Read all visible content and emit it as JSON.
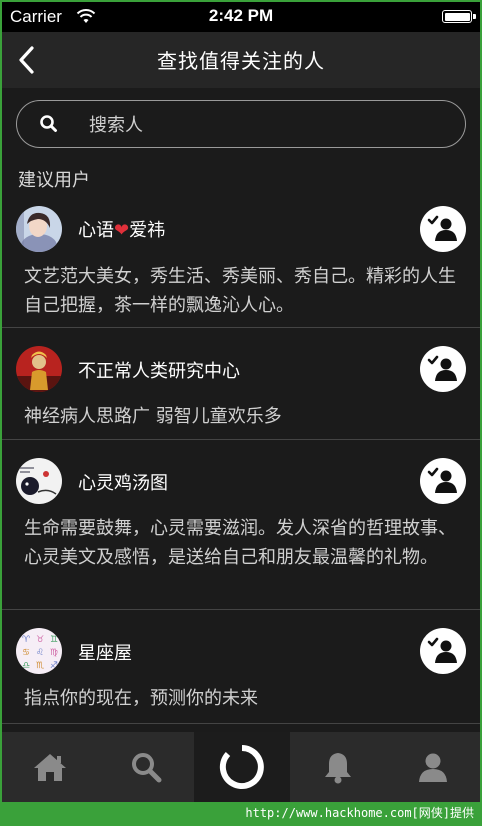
{
  "status_bar": {
    "carrier": "Carrier",
    "time": "2:42 PM",
    "battery_level": 1.0
  },
  "nav": {
    "title": "查找值得关注的人"
  },
  "search": {
    "placeholder": "搜索人"
  },
  "section": {
    "title": "建议用户"
  },
  "users": [
    {
      "name_before": "心语",
      "name_emoji": "❤",
      "name_after": "爱祎",
      "description": "文艺范大美女，秀生活、秀美丽、秀自己。精彩的人生自己把握，茶一样的飘逸沁人心。"
    },
    {
      "name": "不正常人类研究中心",
      "description": "神经病人思路广 弱智儿童欢乐多"
    },
    {
      "name": "心灵鸡汤图",
      "description": "生命需要鼓舞，心灵需要滋润。发人深省的哲理故事、心灵美文及感悟，是送给自己和朋友最温馨的礼物。"
    },
    {
      "name": "星座屋",
      "description": "指点你的现在，预测你的未来"
    }
  ],
  "tabbar": {
    "items": [
      "home-icon",
      "search-icon",
      "refresh-icon",
      "bell-icon",
      "profile-icon"
    ],
    "active_index": 2
  },
  "footer": {
    "text": "http://www.hackhome.com[网侠]提供"
  },
  "colors": {
    "background": "#1b1b1b",
    "navbar": "#262626",
    "tabbar": "#2b2b2b",
    "heart": "#e0303a",
    "footer_strip": "#3aa13a"
  }
}
